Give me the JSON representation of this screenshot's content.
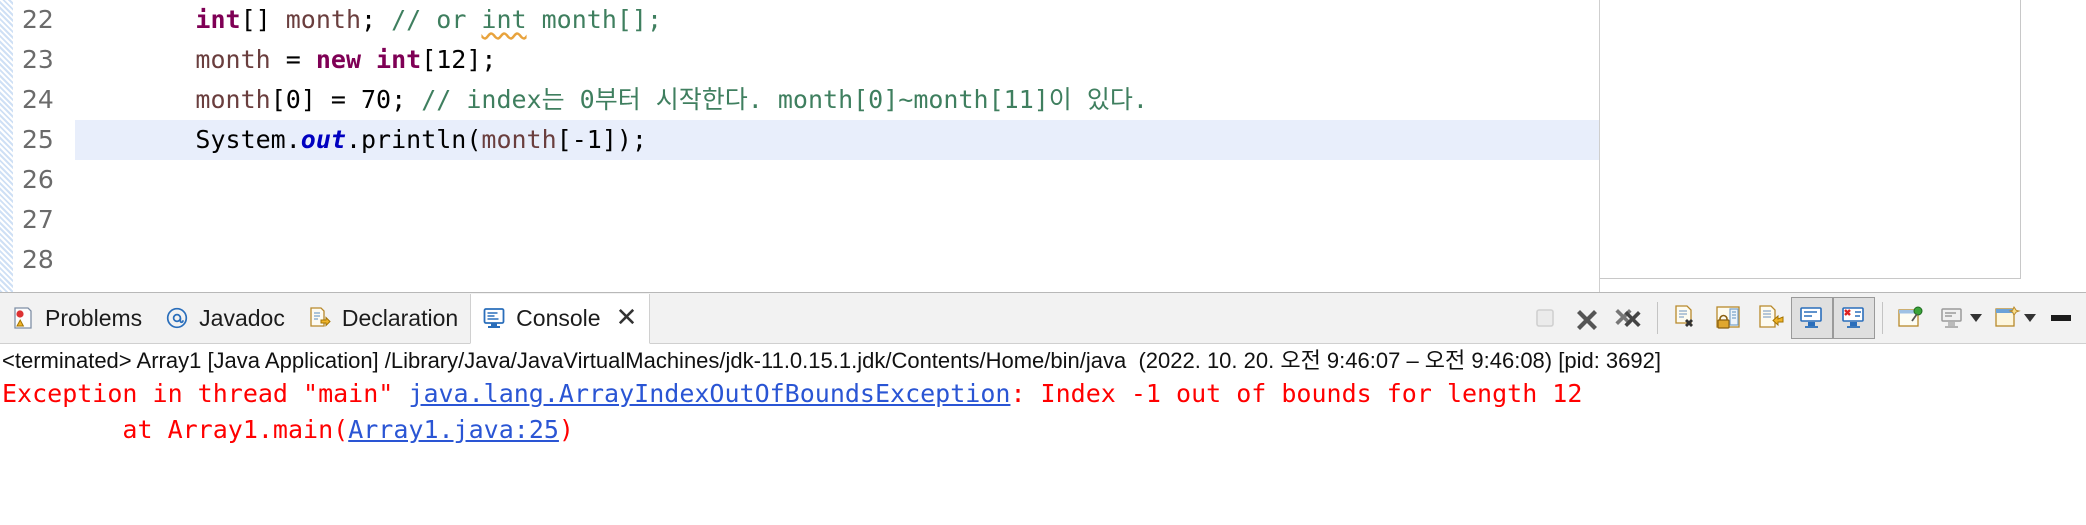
{
  "editor": {
    "lines": [
      {
        "number": "22",
        "highlight": false,
        "tokens": [
          {
            "text": "        ",
            "style": "plain"
          },
          {
            "text": "int",
            "style": "kw"
          },
          {
            "text": "[] ",
            "style": "plain"
          },
          {
            "text": "month",
            "style": "field"
          },
          {
            "text": "; ",
            "style": "plain"
          },
          {
            "text": "// or ",
            "style": "comment"
          },
          {
            "text": "int",
            "style": "warn"
          },
          {
            "text": " month[];",
            "style": "comment"
          }
        ]
      },
      {
        "number": "23",
        "highlight": false,
        "tokens": [
          {
            "text": "        ",
            "style": "plain"
          },
          {
            "text": "month",
            "style": "field"
          },
          {
            "text": " = ",
            "style": "plain"
          },
          {
            "text": "new int",
            "style": "kw"
          },
          {
            "text": "[12];",
            "style": "plain"
          }
        ]
      },
      {
        "number": "24",
        "highlight": false,
        "tokens": [
          {
            "text": "        ",
            "style": "plain"
          },
          {
            "text": "month",
            "style": "field"
          },
          {
            "text": "[0] = 70; ",
            "style": "plain"
          },
          {
            "text": "// index는 0부터 시작한다. month[0]~month[11]이 있다.",
            "style": "comment"
          }
        ]
      },
      {
        "number": "25",
        "highlight": true,
        "tokens": [
          {
            "text": "        System.",
            "style": "plain"
          },
          {
            "text": "out",
            "style": "static"
          },
          {
            "text": ".println(",
            "style": "plain"
          },
          {
            "text": "month",
            "style": "field"
          },
          {
            "text": "[-1]);",
            "style": "plain"
          }
        ]
      },
      {
        "number": "26",
        "highlight": false,
        "tokens": []
      },
      {
        "number": "27",
        "highlight": false,
        "tokens": []
      },
      {
        "number": "28",
        "highlight": false,
        "tokens": []
      }
    ]
  },
  "console": {
    "tabs": [
      {
        "label": "Problems",
        "icon": "problems-icon",
        "active": false,
        "closable": false
      },
      {
        "label": "Javadoc",
        "icon": "javadoc-icon",
        "active": false,
        "closable": false
      },
      {
        "label": "Declaration",
        "icon": "declaration-icon",
        "active": false,
        "closable": false
      },
      {
        "label": "Console",
        "icon": "console-icon",
        "active": true,
        "closable": true,
        "close_label": "✕"
      }
    ],
    "toolbar": [
      {
        "name": "terminate-button",
        "icon": "stop-square-icon",
        "pressed": false,
        "enabled": false
      },
      {
        "name": "remove-launch-button",
        "icon": "remove-x-icon",
        "pressed": false,
        "enabled": true
      },
      {
        "name": "remove-all-terminated-button",
        "icon": "remove-all-xx-icon",
        "pressed": false,
        "enabled": true
      },
      {
        "name": "clear-console-button",
        "icon": "clear-console-icon",
        "pressed": false,
        "enabled": true
      },
      {
        "name": "scroll-lock-button",
        "icon": "lock-scroll-icon",
        "pressed": false,
        "enabled": true
      },
      {
        "name": "word-wrap-button",
        "icon": "word-wrap-icon",
        "pressed": false,
        "enabled": true
      },
      {
        "name": "show-console-on-output-button",
        "icon": "console-out-icon",
        "pressed": true,
        "enabled": true
      },
      {
        "name": "show-console-on-error-button",
        "icon": "console-err-icon",
        "pressed": true,
        "enabled": true
      },
      {
        "name": "pin-console-button",
        "icon": "pin-icon",
        "pressed": false,
        "enabled": true
      },
      {
        "name": "display-selected-console-button",
        "icon": "display-console-icon",
        "pressed": false,
        "enabled": true
      },
      {
        "name": "open-console-button",
        "icon": "open-console-icon",
        "pressed": false,
        "enabled": true
      },
      {
        "name": "minimize-panel-button",
        "icon": "minimize-icon",
        "pressed": false,
        "enabled": true
      }
    ],
    "status_line": "<terminated> Array1 [Java Application] /Library/Java/JavaVirtualMachines/jdk-11.0.15.1.jdk/Contents/Home/bin/java  (2022. 10. 20. 오전 9:46:07 – 오전 9:46:08) [pid: 3692]",
    "output": [
      {
        "segments": [
          {
            "text": "Exception in thread \"main\" ",
            "style": "err"
          },
          {
            "text": "java.lang.ArrayIndexOutOfBoundsException",
            "style": "link"
          },
          {
            "text": ": Index -1 out of bounds for length 12",
            "style": "err"
          }
        ]
      },
      {
        "segments": [
          {
            "text": "\tat Array1.main(",
            "style": "err"
          },
          {
            "text": "Array1.java:25",
            "style": "link"
          },
          {
            "text": ")",
            "style": "err"
          }
        ]
      }
    ]
  },
  "colors": {
    "keyword": "#7f0055",
    "comment": "#3f7f5f",
    "field": "#6a3e3e",
    "static_field": "#0000c0",
    "error": "#ff0000",
    "link": "#2a55d4",
    "line_highlight": "#e8eefb"
  }
}
